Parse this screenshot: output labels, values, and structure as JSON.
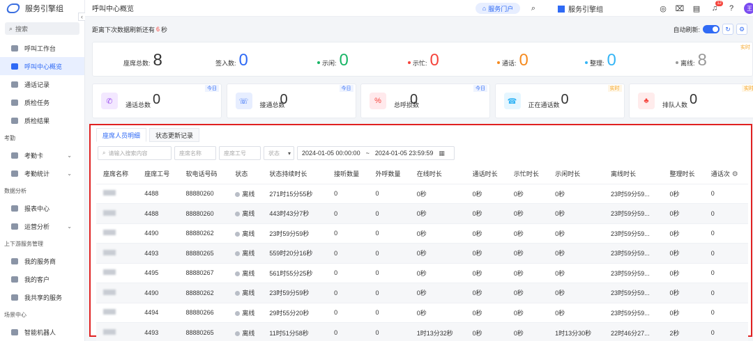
{
  "app": {
    "brand": "服务引擎组",
    "page_title": "呼叫中心概览"
  },
  "sidebar": {
    "search_label": "搜索",
    "items": [
      {
        "label": "呼叫工作台",
        "icon": "workbench-icon",
        "active": false
      },
      {
        "label": "呼叫中心概览",
        "icon": "monitor-icon",
        "active": true
      },
      {
        "label": "通话记录",
        "icon": "phone-record-icon",
        "active": false
      },
      {
        "label": "质检任务",
        "icon": "shield-icon",
        "active": false
      },
      {
        "label": "质检结果",
        "icon": "document-icon",
        "active": false
      }
    ],
    "group_attendance": "考勤",
    "attendance_items": [
      {
        "label": "考勤卡",
        "icon": "card-icon"
      },
      {
        "label": "考勤统计",
        "icon": "stats-icon"
      }
    ],
    "group_analysis": "数据分析",
    "analysis_items": [
      {
        "label": "报表中心",
        "icon": "bar-chart-icon"
      },
      {
        "label": "运营分析",
        "icon": "analysis-icon"
      }
    ],
    "group_upstream": "上下游服务管理",
    "upstream_items": [
      {
        "label": "我的服务商",
        "icon": "provider-icon"
      },
      {
        "label": "我的客户",
        "icon": "customer-icon"
      },
      {
        "label": "我共享的服务",
        "icon": "share-icon"
      }
    ],
    "group_scene": "场景中心",
    "scene_items": [
      {
        "label": "智能机器人",
        "icon": "robot-icon"
      }
    ]
  },
  "topbar": {
    "portal_label": "服务门户",
    "org_name": "服务引擎组",
    "notif_count": "12",
    "avatar_letter": "王"
  },
  "refresh": {
    "prefix": "距离下次数据刷新还有",
    "seconds": "6",
    "suffix": "秒",
    "auto_label": "自动刷新:"
  },
  "agents": {
    "realtime_tag": "实时",
    "total_label": "座席总数:",
    "total_value": "8",
    "signed_label": "签入数:",
    "signed_value": "0",
    "idle_label": "示闲:",
    "idle_value": "0",
    "busy_label": "示忙:",
    "busy_value": "0",
    "talk_label": "通话:",
    "talk_value": "0",
    "sort_label": "整理:",
    "sort_value": "0",
    "offline_label": "离线:",
    "offline_value": "8"
  },
  "colors": {
    "accent": "#2f6af5",
    "idle": "#18b566",
    "busy": "#f5433b",
    "talk": "#f58a1f",
    "sort": "#35b5f5",
    "offline": "#999999"
  },
  "kpis": [
    {
      "label": "通话总数",
      "value": "0",
      "tag": "今日",
      "icon": "phone-icon"
    },
    {
      "label": "接通总数",
      "value": "0",
      "tag": "今日",
      "icon": "connected-icon"
    },
    {
      "label": "总呼损数",
      "value": "0",
      "tag": "今日",
      "icon": "percent-icon"
    },
    {
      "label": "正在通话数",
      "value": "0",
      "tag": "实时",
      "icon": "calling-icon"
    },
    {
      "label": "排队人数",
      "value": "0",
      "tag": "实时",
      "icon": "queue-icon"
    }
  ],
  "panel": {
    "tabs": [
      "座席人员明细",
      "状态更新记录"
    ],
    "filters": {
      "search_placeholder": "请输入搜索内容",
      "name_placeholder": "座席名称",
      "id_placeholder": "座席工号",
      "status_placeholder": "状态",
      "date_start": "2024-01-05 00:00:00",
      "date_sep": "~",
      "date_end": "2024-01-05 23:59:59"
    },
    "columns": [
      "座席名称",
      "座席工号",
      "软电话号码",
      "状态",
      "状态持续时长",
      "接听数量",
      "外呼数量",
      "在线时长",
      "通话时长",
      "示忙时长",
      "示闲时长",
      "离线时长",
      "整理时长",
      "通话次"
    ],
    "rows": [
      [
        "4488",
        "88880260",
        "离线",
        "271时15分55秒",
        "0",
        "0",
        "0秒",
        "0秒",
        "0秒",
        "0秒",
        "23时59分59...",
        "0秒",
        "0"
      ],
      [
        "4488",
        "88880260",
        "离线",
        "443时43分7秒",
        "0",
        "0",
        "0秒",
        "0秒",
        "0秒",
        "0秒",
        "23时59分59...",
        "0秒",
        "0"
      ],
      [
        "4490",
        "88880262",
        "离线",
        "23时59分59秒",
        "0",
        "0",
        "0秒",
        "0秒",
        "0秒",
        "0秒",
        "23时59分59...",
        "0秒",
        "0"
      ],
      [
        "4493",
        "88880265",
        "离线",
        "559时20分16秒",
        "0",
        "0",
        "0秒",
        "0秒",
        "0秒",
        "0秒",
        "23时59分59...",
        "0秒",
        "0"
      ],
      [
        "4495",
        "88880267",
        "离线",
        "561时55分25秒",
        "0",
        "0",
        "0秒",
        "0秒",
        "0秒",
        "0秒",
        "23时59分59...",
        "0秒",
        "0"
      ],
      [
        "4490",
        "88880262",
        "离线",
        "23时59分59秒",
        "0",
        "0",
        "0秒",
        "0秒",
        "0秒",
        "0秒",
        "23时59分59...",
        "0秒",
        "0"
      ],
      [
        "4494",
        "88880266",
        "离线",
        "29时55分20秒",
        "0",
        "0",
        "0秒",
        "0秒",
        "0秒",
        "0秒",
        "23时59分59...",
        "0秒",
        "0"
      ],
      [
        "4493",
        "88880265",
        "离线",
        "11时51分58秒",
        "0",
        "0",
        "1时13分32秒",
        "0秒",
        "0秒",
        "1时13分30秒",
        "22时46分27...",
        "2秒",
        "0"
      ]
    ]
  }
}
